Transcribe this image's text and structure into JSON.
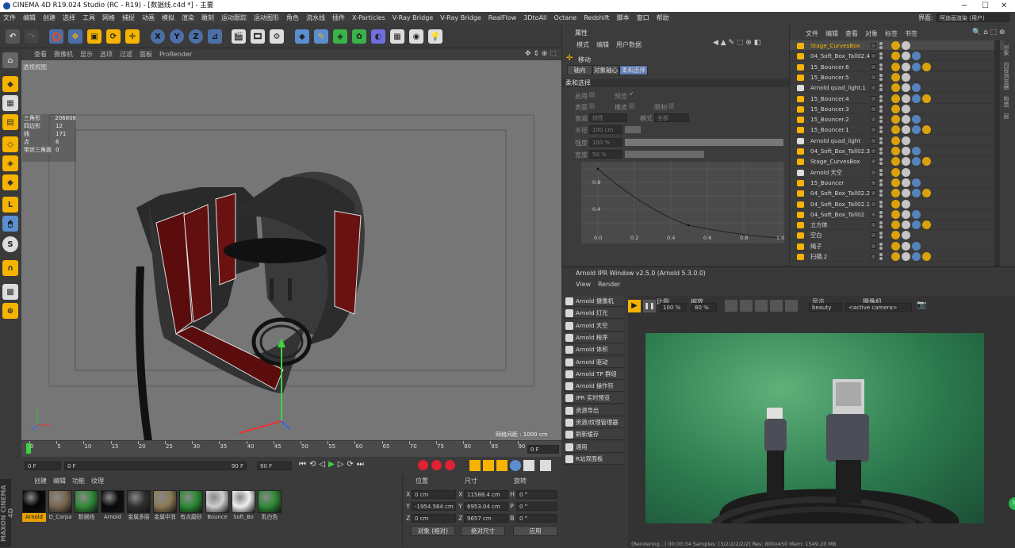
{
  "window": {
    "title": "CINEMA 4D R19.024 Studio (RC - R19) - [数据线.c4d *] - 主要",
    "layout_label": "界面:",
    "layout_value": "阿迪画渲染 (用户)"
  },
  "menu": [
    "文件",
    "编辑",
    "创建",
    "选择",
    "工具",
    "网格",
    "捕捉",
    "动画",
    "模拟",
    "渲染",
    "雕刻",
    "运动跟踪",
    "运动图形",
    "角色",
    "流水线",
    "插件",
    "X-Particles",
    "V-Ray Bridge",
    "V-Ray Bridge",
    "RealFlow",
    "3DtoAll",
    "Octane",
    "Redshift",
    "脚本",
    "窗口",
    "帮助"
  ],
  "toolbar": {
    "axis_x": "X",
    "axis_y": "Y",
    "axis_z": "Z"
  },
  "viewport": {
    "menu": [
      "查看",
      "摄像机",
      "显示",
      "选项",
      "过滤",
      "面板",
      "ProRender"
    ],
    "name": "透视视图",
    "grid_spacing": "网格间距 : 1000 cm",
    "stats": [
      {
        "label": "三角形",
        "value": "206806"
      },
      {
        "label": "四边形",
        "value": "12"
      },
      {
        "label": "线",
        "value": "171"
      },
      {
        "label": "点",
        "value": "6"
      },
      {
        "label": "带状三角面",
        "value": "0"
      }
    ]
  },
  "timeline": {
    "ticks": [
      "0",
      "5",
      "10",
      "15",
      "20",
      "25",
      "30",
      "35",
      "40",
      "45",
      "50",
      "55",
      "60",
      "65",
      "70",
      "75",
      "80",
      "85",
      "90"
    ],
    "end_frame": "0 F"
  },
  "playback": {
    "current": "0 F",
    "start": "0 F",
    "end": "90 F",
    "end2": "90 F"
  },
  "materials": {
    "menu": [
      "创建",
      "编辑",
      "功能",
      "纹理"
    ],
    "items": [
      {
        "name": "Arnold",
        "color": "#050505"
      },
      {
        "name": "D_Carpa",
        "color": "#7a6650"
      },
      {
        "name": "数据线",
        "color": "#2f8a36"
      },
      {
        "name": "Arnold",
        "color": "#0a0a0a"
      },
      {
        "name": "金属多层",
        "color": "#303030"
      },
      {
        "name": "金属中消",
        "color": "#8a7a55"
      },
      {
        "name": "有点磨砂",
        "color": "#2a8a33"
      },
      {
        "name": "Bounce",
        "color": "#cfcfcf"
      },
      {
        "name": "Soft_Bo",
        "color": "#f0f0f0"
      },
      {
        "name": "乳白色",
        "color": "#2e8a36"
      }
    ]
  },
  "coords": {
    "headers": [
      "位置",
      "尺寸",
      "旋转"
    ],
    "rows": [
      {
        "axis": "X",
        "pos": "0 cm",
        "size": "11588.4 cm",
        "rlabel": "H",
        "rot": "0 °"
      },
      {
        "axis": "Y",
        "pos": "-1954.564 cm",
        "size": "6953.04 cm",
        "rlabel": "P",
        "rot": "0 °"
      },
      {
        "axis": "Z",
        "pos": "0 cm",
        "size": "9657 cm",
        "rlabel": "B",
        "rot": "0 °"
      }
    ],
    "mode": "对象 (相对)",
    "size_mode": "绝对尺寸",
    "apply": "应用"
  },
  "attributes": {
    "title": "属性",
    "menu": [
      "模式",
      "编辑",
      "用户数据"
    ],
    "tool": "移动",
    "tabs": [
      "轴向",
      "对象轴心",
      "柔和选择"
    ],
    "section": "柔和选择",
    "enable": "启用",
    "preview": "预览",
    "surface": "表面",
    "rubber": "橡皮",
    "restrict": "限制",
    "falloff": "衰减",
    "falloff_val": "线性",
    "mode": "模式",
    "mode_val": "全部",
    "radius": "半径",
    "radius_val": "100 cm",
    "strength": "强度",
    "strength_val": "100 %",
    "width": "宽度",
    "width_val": "50 %",
    "graph_y": [
      "0.8",
      "0.4"
    ],
    "graph_x": [
      "0.0",
      "0.2",
      "0.4",
      "0.6",
      "0.8",
      "1.0"
    ]
  },
  "objects": {
    "menu": [
      "文件",
      "编辑",
      "查看",
      "对象",
      "标签",
      "书签"
    ],
    "items": [
      "Stage_CurvesBox",
      "04_Soft_Box_Tall02.4",
      "15_Bouncer.6",
      "15_Bouncer.5",
      "Arnold quad_light.1",
      "15_Bouncer.4",
      "15_Bouncer.3",
      "15_Bouncer.2",
      "15_Bouncer.1",
      "Arnold quad_light",
      "04_Soft_Box_Tall02.3",
      "Stage_CurvesBox",
      "Arnold 天空",
      "15_Bouncer",
      "04_Soft_Box_Tall02.2",
      "04_Soft_Box_Tall02.1",
      "04_Soft_Box_Tall02",
      "立方体",
      "空白",
      "绳子",
      "扫描.2"
    ],
    "side_tabs": [
      "对象",
      "内容浏览器",
      "构造",
      "层"
    ]
  },
  "ipr": {
    "title": "Arnold IPR Window v2.5.0 (Arnold 5.3.0.0)",
    "menu": [
      "View",
      "Render"
    ],
    "ratio_label": "比例",
    "ratio": "100 %",
    "zoom_label": "缩放",
    "zoom": "80 %",
    "display_label": "显示",
    "display": "beauty",
    "camera_label": "摄像机",
    "camera": "<active camera>",
    "status": "(Rendering...) 00:00:34  Samples: [3/2/2/2/2/2]  Res: 800x450  Mem: 1549.20 MB",
    "side": [
      "Arnold 摄像机",
      "Arnold 灯光",
      "Arnold 天空",
      "Arnold 程序",
      "Arnold 体积",
      "Arnold 驱动",
      "Arnold TP 群组",
      "Arnold 操作符",
      "IPR 实时预览",
      "资源导出",
      "资源/纹理管理器",
      "刷新缓存",
      "通用",
      "R站双面板"
    ],
    "badge": "31"
  }
}
